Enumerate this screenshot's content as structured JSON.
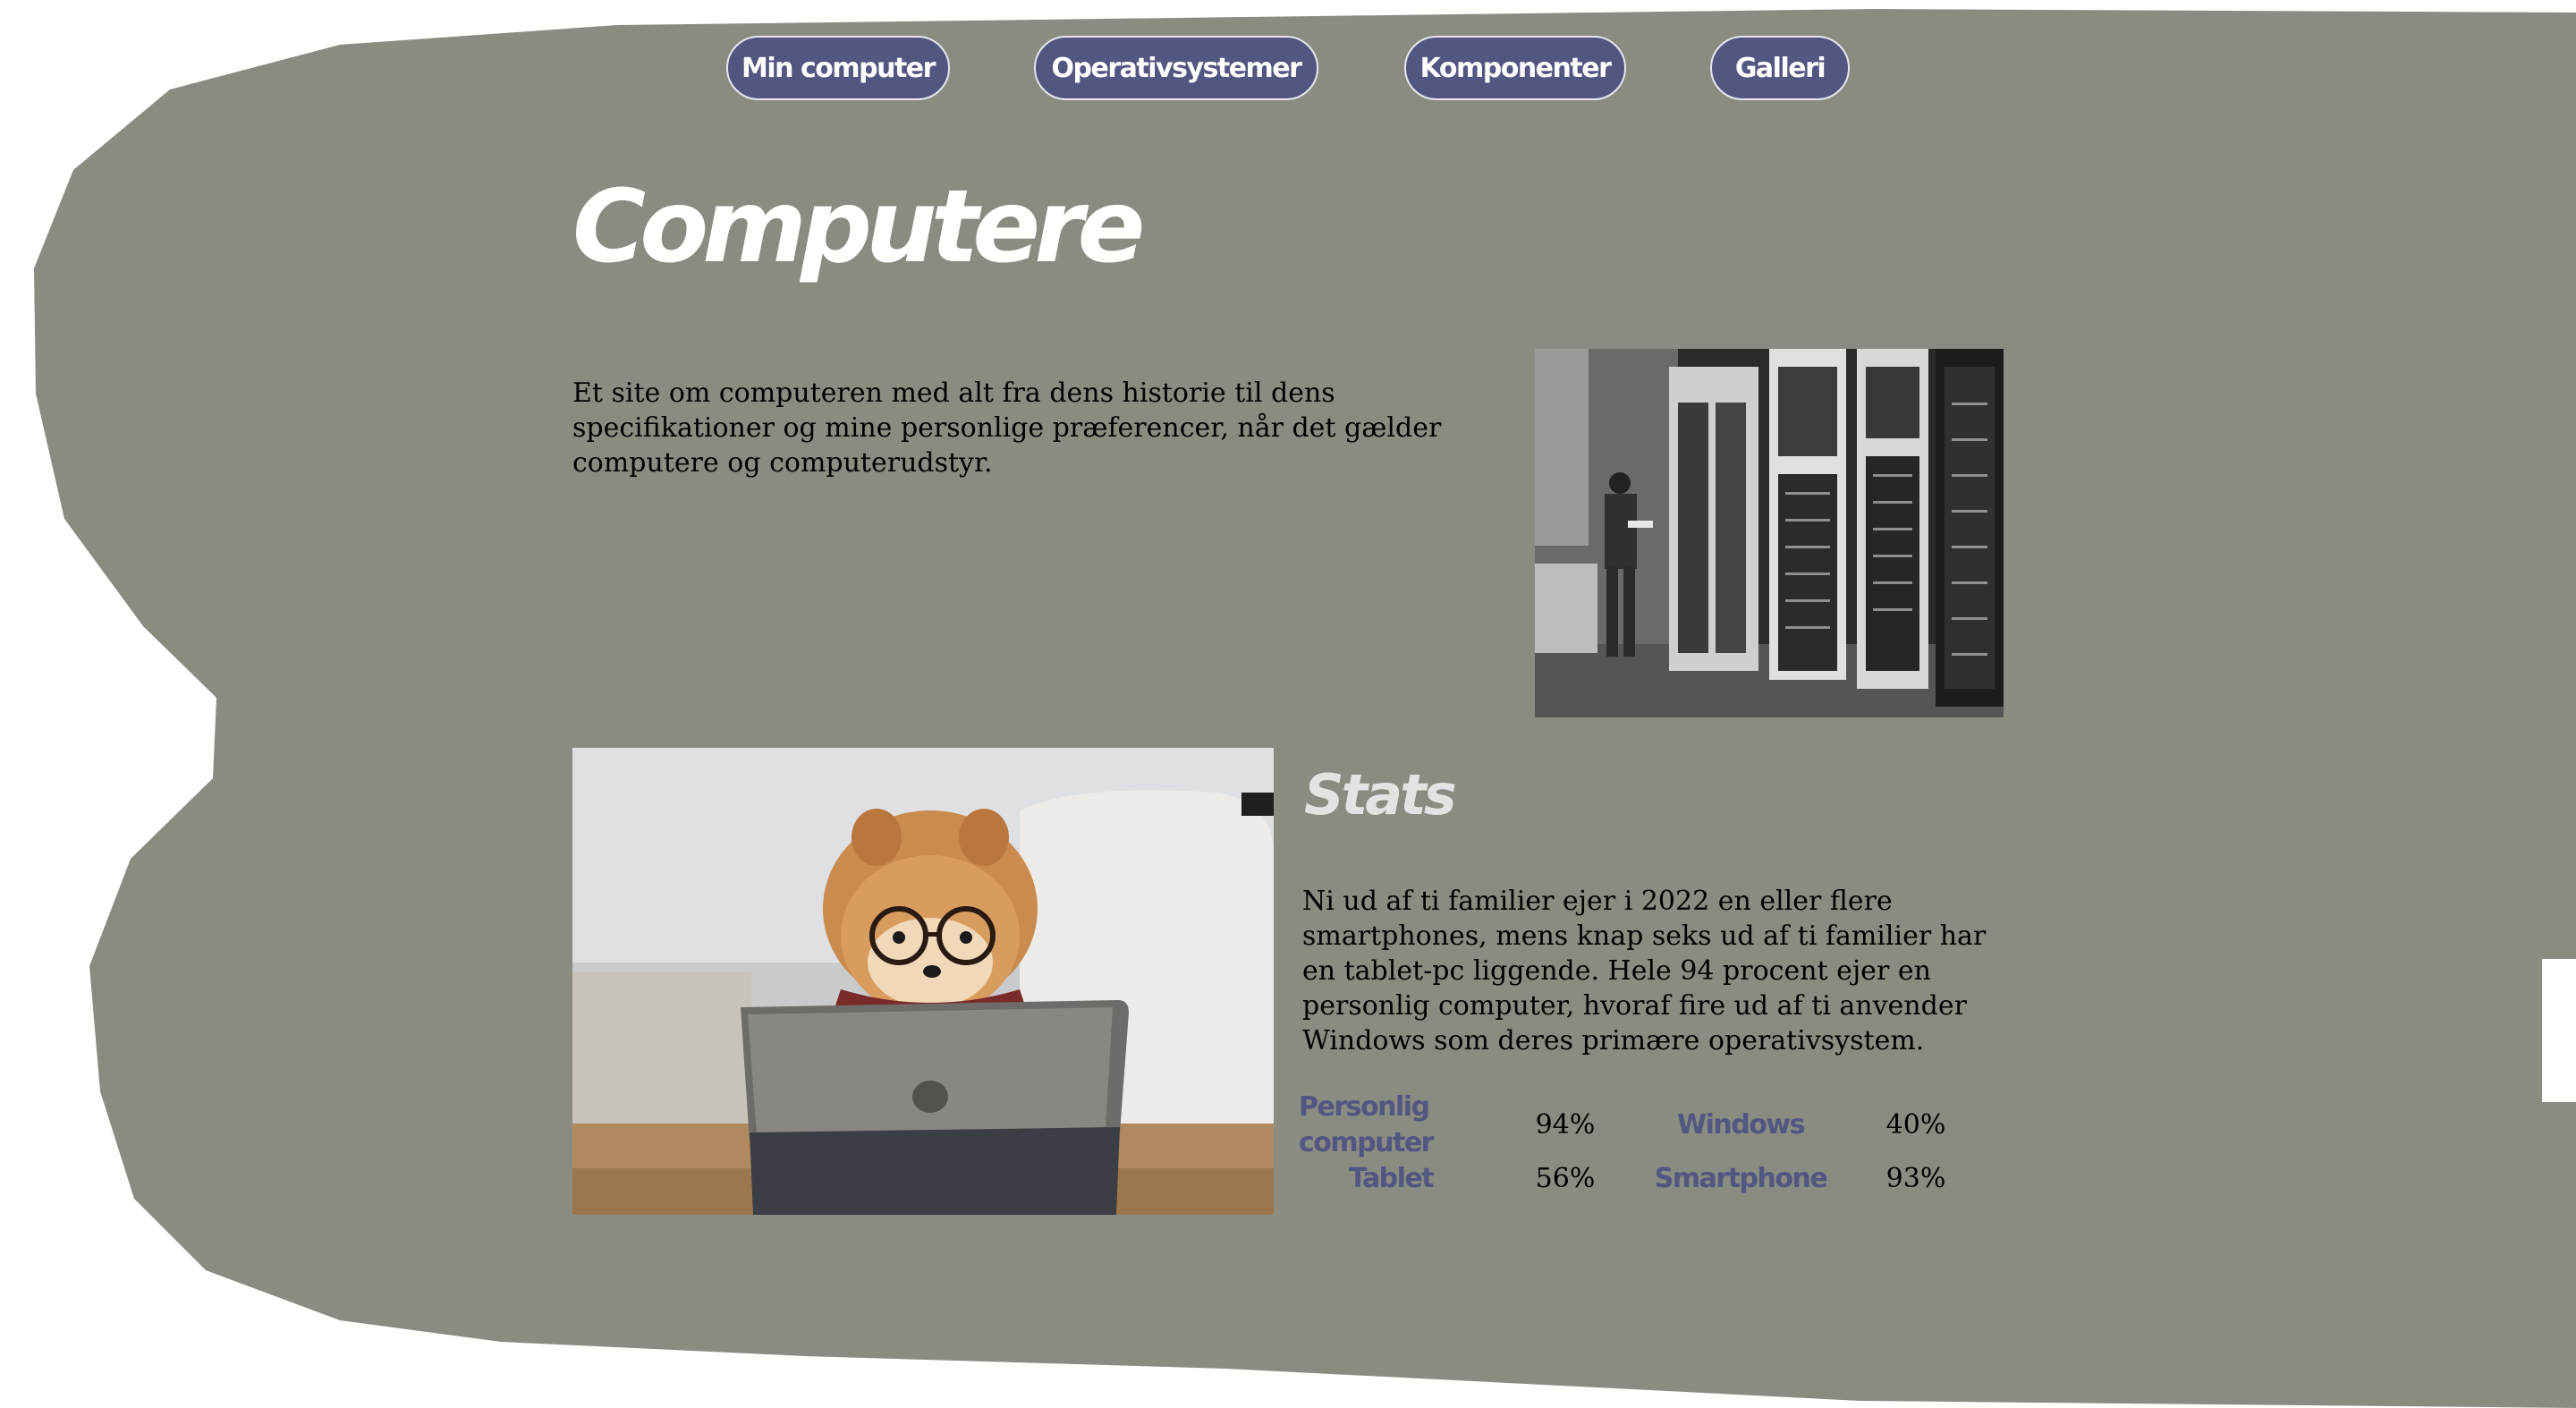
{
  "colors": {
    "page_background": "#ffffff",
    "blob_background": "#8a8c82",
    "nav_button": "#525680",
    "nav_button_text": "#ffffff",
    "title": "#ffffff",
    "stats_heading": "#e3e3e3",
    "stat_label": "#525680",
    "body_text": "#000000"
  },
  "nav": {
    "items": [
      {
        "label": "Min computer"
      },
      {
        "label": "Operativsystemer"
      },
      {
        "label": "Komponenter"
      },
      {
        "label": "Galleri"
      }
    ]
  },
  "hero": {
    "title": "Computere",
    "intro": "Et site om computeren med alt fra dens historie til dens specifikationer og mine personlige præferencer, når det gælder computere og computerudstyr."
  },
  "stats": {
    "heading": "Stats",
    "text": "Ni ud af ti familier ejer i 2022 en eller flere smartphones, mens knap seks ud af ti familier har en tablet-pc liggende. Hele 94 procent ejer en personlig computer, hvoraf fire ud af ti anvender Windows som deres primære operativsystem.",
    "rows": [
      [
        {
          "label": "Personlig computer",
          "value": "94%"
        },
        {
          "label": "Windows",
          "value": "40%"
        }
      ],
      [
        {
          "label": "Tablet",
          "value": "56%"
        },
        {
          "label": "Smartphone",
          "value": "93%"
        }
      ]
    ]
  }
}
